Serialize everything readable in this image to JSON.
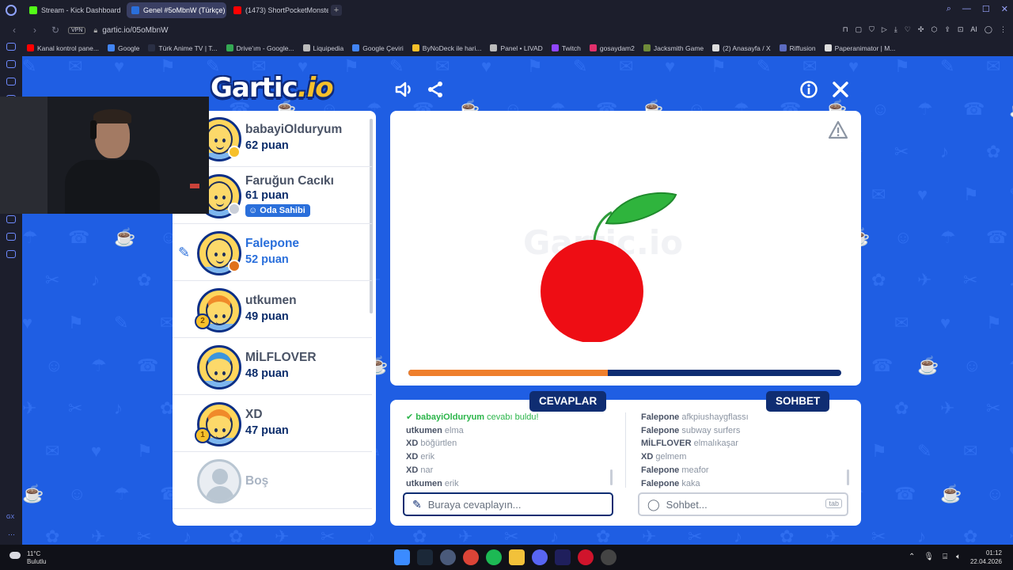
{
  "browser": {
    "tabs": [
      {
        "label": "Stream - Kick Dashboard",
        "color": "#53fc18"
      },
      {
        "label": "Genel #5oMbnW (Türkçe)",
        "color": "#2a6fdb",
        "active": true
      },
      {
        "label": "(1473) ShortPocketMonste",
        "color": "#ff0000"
      }
    ],
    "new_tab": "+",
    "vpn": "VPN",
    "url": "gartic.io/05oMbnW",
    "ai_label": "AI",
    "bookmarks": [
      {
        "label": "Kanal kontrol pane...",
        "color": "#ff0000"
      },
      {
        "label": "Google",
        "color": "#4285f4"
      },
      {
        "label": "Türk Anime TV | T...",
        "color": "#2a2f44"
      },
      {
        "label": "Drive'ım - Google...",
        "color": "#34a853"
      },
      {
        "label": "Liquipedia",
        "color": "#bbbbbb"
      },
      {
        "label": "Google Çeviri",
        "color": "#4285f4"
      },
      {
        "label": "ByNoDeck ile hari...",
        "color": "#f7c02a"
      },
      {
        "label": "Panel • LIVAD",
        "color": "#bbbbbb"
      },
      {
        "label": "Twitch",
        "color": "#9146ff"
      },
      {
        "label": "gosaydam2",
        "color": "#e1306c"
      },
      {
        "label": "Jacksmith Game",
        "color": "#6f8b3a"
      },
      {
        "label": "(2) Anasayfa / X",
        "color": "#dddddd"
      },
      {
        "label": "Riffusion",
        "color": "#5c6bc0"
      },
      {
        "label": "Paperanimator | M...",
        "color": "#dddddd"
      }
    ]
  },
  "game": {
    "logo_main": "Gartic",
    "logo_suffix": ".io",
    "watermark": "Gartic.io",
    "progress": 0.46,
    "players": [
      {
        "name": "babayiOlduryum",
        "score": "62 puan",
        "status": "#f7c02a",
        "avatar": "plain"
      },
      {
        "name": "Faruğun Cacıkı",
        "score": "61 puan",
        "status": "#c9ced8",
        "avatar": "plain",
        "badge": "Oda Sahibi"
      },
      {
        "name": "Falepone",
        "score": "52 puan",
        "status": "#e0711c",
        "avatar": "plain",
        "drawing": true
      },
      {
        "name": "utkumen",
        "score": "49 puan",
        "avatar": "hair-orange",
        "trophy": "2"
      },
      {
        "name": "MİLFLOVER",
        "score": "48 puan",
        "avatar": "hair-blue"
      },
      {
        "name": "XD",
        "score": "47 puan",
        "avatar": "hair-orange",
        "trophy": "1"
      },
      {
        "name": "Boş",
        "score": "",
        "avatar": "empty"
      }
    ],
    "answers_tab": "CEVAPLAR",
    "chat_tab": "SOHBET",
    "answers": [
      {
        "user": "babayiOlduryum",
        "text": "cevabı buldu!",
        "correct": true
      },
      {
        "user": "utkumen",
        "text": "elma"
      },
      {
        "user": "XD",
        "text": "böğürtlen"
      },
      {
        "user": "XD",
        "text": "erik"
      },
      {
        "user": "XD",
        "text": "nar"
      },
      {
        "user": "utkumen",
        "text": "erik"
      }
    ],
    "chat": [
      {
        "user": "Falepone",
        "text": "afkpiushaygflassı"
      },
      {
        "user": "Falepone",
        "text": "subway surfers"
      },
      {
        "user": "MİLFLOVER",
        "text": "elmalıkaşar"
      },
      {
        "user": "XD",
        "text": "gelmem"
      },
      {
        "user": "Falepone",
        "text": "meafor"
      },
      {
        "user": "Falepone",
        "text": "kaka"
      }
    ],
    "answer_placeholder": "Buraya cevaplayın...",
    "chat_placeholder": "Sohbet...",
    "chat_key": "tab"
  },
  "taskbar": {
    "temperature": "11°C",
    "condition": "Bulutlu",
    "time": "01:12",
    "date": "22.04.2026",
    "left_label": "GX"
  }
}
